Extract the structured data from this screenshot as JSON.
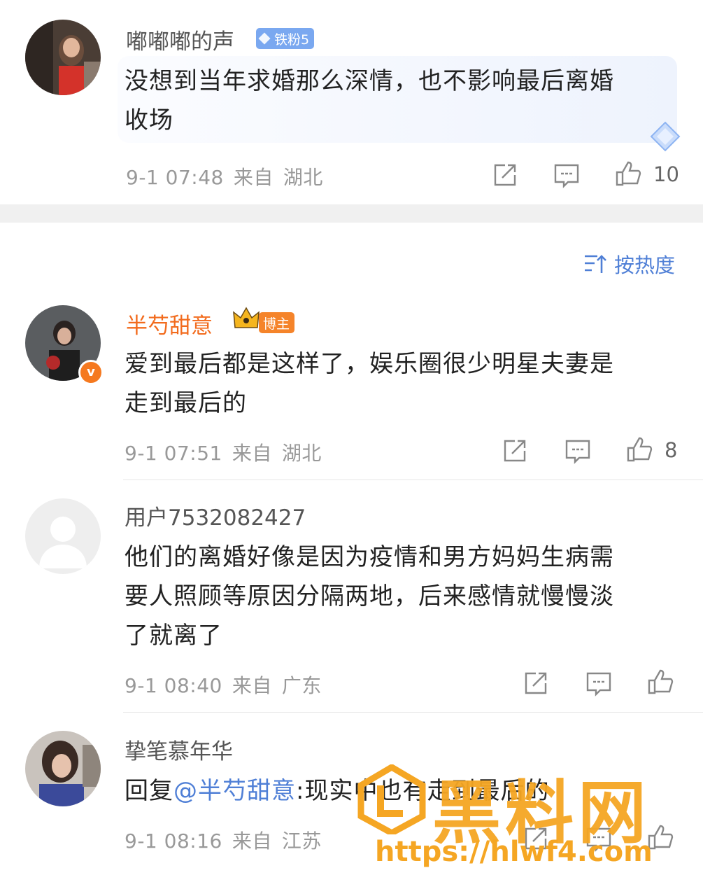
{
  "colors": {
    "accent_blue": "#4f7fd6",
    "vip_orange": "#f26b1d",
    "meta_gray": "#999999",
    "separator": "#f0f0f0"
  },
  "comments": [
    {
      "username": "嘟嘟嘟的声",
      "badge": "铁粉5",
      "text_line1": "没想到当年求婚那么深情，也不影响最后离婚",
      "text_line2": "收场",
      "date": "9-1 07:48",
      "from": "来自",
      "location": "湖北",
      "likes": "10"
    }
  ],
  "sort": {
    "icon": "sort-icon",
    "label": "按热度"
  },
  "replies": [
    {
      "username": "半芍甜意",
      "badge": "博主",
      "text_line1": "爱到最后都是这样了，娱乐圈很少明星夫妻是",
      "text_line2": "走到最后的",
      "date": "9-1 07:51",
      "from": "来自",
      "location": "湖北",
      "likes": "8"
    },
    {
      "username": "用户7532082427",
      "text_line1": "他们的离婚好像是因为疫情和男方妈妈生病需",
      "text_line2": "要人照顾等原因分隔两地，后来感情就慢慢淡",
      "text_line3": "了就离了",
      "date": "9-1 08:40",
      "from": "来自",
      "location": "广东"
    },
    {
      "username": "挚笔慕年华",
      "reply_prefix": "回复",
      "mention": "@半芍甜意",
      "text_rest": ":现实中也有走到最后的",
      "date": "9-1 08:16",
      "from": "来自",
      "location": "江苏"
    }
  ],
  "watermark": {
    "logo_text": "黑料网",
    "url": "https://hlwf4.com"
  }
}
